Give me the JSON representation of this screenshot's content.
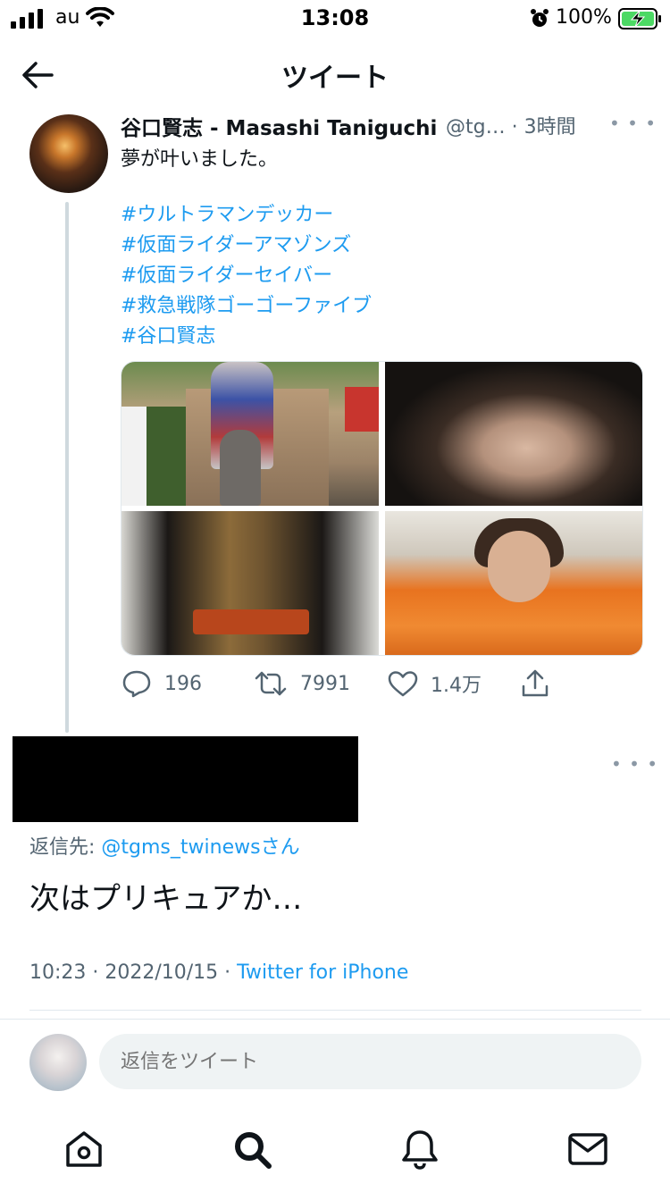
{
  "status_bar": {
    "carrier": "au",
    "time": "13:08",
    "battery": "100%"
  },
  "header": {
    "title": "ツイート",
    "back_icon": "arrow-left-icon"
  },
  "tweet": {
    "author_name": "谷口賢志 - Masashi Taniguchi",
    "handle_time": "@tg… · 3時間",
    "text": "夢が叶いました。",
    "hashtags": [
      "#ウルトラマンデッカー",
      "#仮面ライダーアマゾンズ",
      "#仮面ライダーセイバー",
      "#救急戦隊ゴーゴーファイブ",
      "#谷口賢志"
    ],
    "media_count": 4,
    "actions": {
      "replies": "196",
      "retweets": "7991",
      "likes": "1.4万"
    }
  },
  "reply": {
    "reply_to_label": "返信先: ",
    "reply_to_handle": "@tgms_twinews",
    "reply_to_suffix": "さん",
    "text": "次はプリキュアか…",
    "timestamp": "10:23 · 2022/10/15 · ",
    "source": "Twitter for iPhone"
  },
  "compose": {
    "placeholder": "返信をツイート"
  },
  "tabbar": {
    "items": [
      "home-icon",
      "search-icon",
      "notifications-icon",
      "messages-icon"
    ]
  },
  "colors": {
    "accent": "#1d9bf0",
    "secondary_text": "#536471",
    "divider": "#e1e8ed"
  }
}
